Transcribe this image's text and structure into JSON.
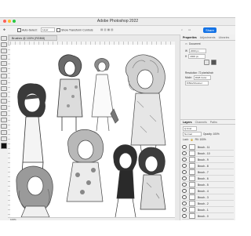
{
  "app": {
    "title": "Adobe Photoshop 2022"
  },
  "options_bar": {
    "auto_select_label": "Auto-Select:",
    "auto_select_value": "Layer",
    "transform_label": "Show Transform Controls",
    "share_label": "Share"
  },
  "document": {
    "tab_label": "Brushes @ 100% (RGB/8)"
  },
  "status": {
    "zoom": "100%"
  },
  "properties": {
    "tabs": [
      "Properties",
      "Adjustments",
      "Libraries"
    ],
    "section_label": "Document",
    "width_label": "W",
    "width_value": "2000 px",
    "height_label": "H",
    "height_value": "2000 px",
    "resolution_label": "Resolution: 72 pixels/inch",
    "mode_label": "Mode:",
    "mode_value": "RGB Color",
    "depth_value": "8 Bits/Channel"
  },
  "layers_panel": {
    "tabs": [
      "Layers",
      "Channels",
      "Paths"
    ],
    "filter_label": "Q Kind",
    "blend_mode": "Normal",
    "opacity_label": "Opacity: 100%",
    "lock_label": "Lock:",
    "fill_label": "Fill: 100%",
    "layers": [
      "Brush - 11",
      "Brush - 10",
      "Brush - 9",
      "Brush - 8",
      "Brush - 7",
      "Brush - 6",
      "Brush - 5",
      "Brush - 4",
      "Brush - 3",
      "Brush - 2",
      "Brush - 1",
      "Brush - 0"
    ]
  },
  "icons": [
    "move-icon",
    "marquee-icon",
    "lasso-icon",
    "crop-icon",
    "eyedropper-icon",
    "healing-icon",
    "brush-icon",
    "stamp-icon",
    "eraser-icon",
    "gradient-icon",
    "blur-icon",
    "pen-icon",
    "type-icon",
    "path-select-icon",
    "shape-icon",
    "hand-icon",
    "zoom-icon",
    "eye-icon",
    "lock-icon"
  ]
}
